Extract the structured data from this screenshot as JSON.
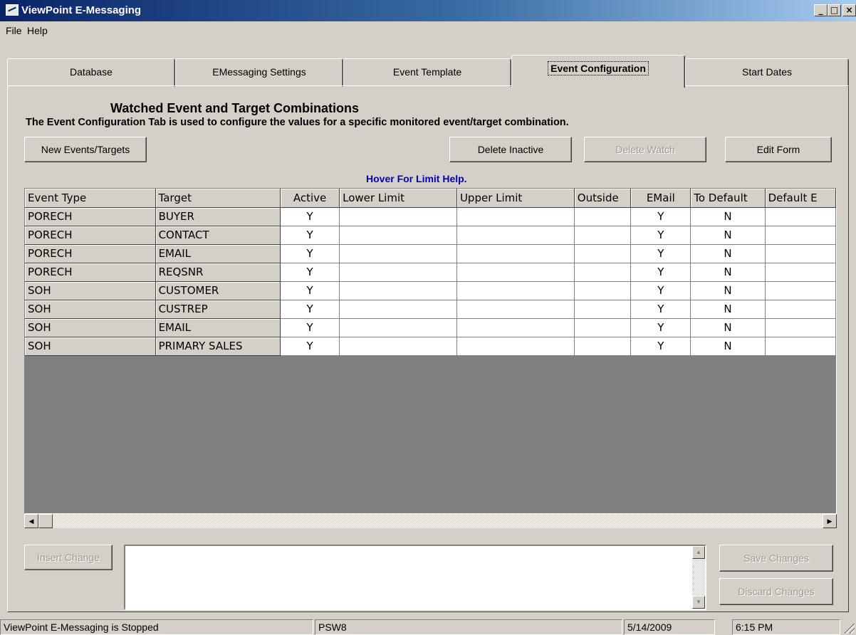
{
  "window": {
    "title": "ViewPoint E-Messaging",
    "controls": [
      "_",
      "□",
      "×"
    ]
  },
  "menu": {
    "file": "File",
    "help": "Help"
  },
  "tabs": [
    {
      "label": "Database",
      "active": false
    },
    {
      "label": "EMessaging Settings",
      "active": false
    },
    {
      "label": "Event Template",
      "active": false
    },
    {
      "label": "Event Configuration",
      "active": true
    },
    {
      "label": "Start Dates",
      "active": false
    }
  ],
  "panel": {
    "heading": "Watched Event and Target Combinations",
    "description": "The Event Configuration Tab is used to configure the values for a specific monitored event/target combination.",
    "buttons": {
      "new_events": "New Events/Targets",
      "delete_inactive": "Delete Inactive",
      "delete_watch": "Delete Watch",
      "edit_form": "Edit Form"
    },
    "hover_help": "Hover For Limit Help."
  },
  "grid": {
    "columns": [
      "Event Type",
      "Target",
      "Active",
      "Lower Limit",
      "Upper Limit",
      "Outside",
      "EMail",
      "To Default",
      "Default E"
    ],
    "rows": [
      [
        "PORECH",
        "BUYER",
        "Y",
        "",
        "",
        "",
        "Y",
        "N",
        ""
      ],
      [
        "PORECH",
        "CONTACT",
        "Y",
        "",
        "",
        "",
        "Y",
        "N",
        ""
      ],
      [
        "PORECH",
        "EMAIL",
        "Y",
        "",
        "",
        "",
        "Y",
        "N",
        ""
      ],
      [
        "PORECH",
        "REQSNR",
        "Y",
        "",
        "",
        "",
        "Y",
        "N",
        ""
      ],
      [
        "SOH",
        "CUSTOMER",
        "Y",
        "",
        "",
        "",
        "Y",
        "N",
        ""
      ],
      [
        "SOH",
        "CUSTREP",
        "Y",
        "",
        "",
        "",
        "Y",
        "N",
        ""
      ],
      [
        "SOH",
        "EMAIL",
        "Y",
        "",
        "",
        "",
        "Y",
        "N",
        ""
      ],
      [
        "SOH",
        "PRIMARY SALES",
        "Y",
        "",
        "",
        "",
        "Y",
        "N",
        ""
      ]
    ]
  },
  "bottom": {
    "insert_change": "Insert Change",
    "memo_text": "",
    "save_changes": "Save Changes",
    "discard_changes": "Discard Changes"
  },
  "status": {
    "state": "ViewPoint E-Messaging is Stopped",
    "server": "PSW8",
    "date": "5/14/2009",
    "time": "6:15 PM"
  },
  "colors": {
    "title_start": "#0a246a",
    "title_end": "#a6caf0",
    "face": "#d4d0c8",
    "help_text": "#0000c0"
  }
}
